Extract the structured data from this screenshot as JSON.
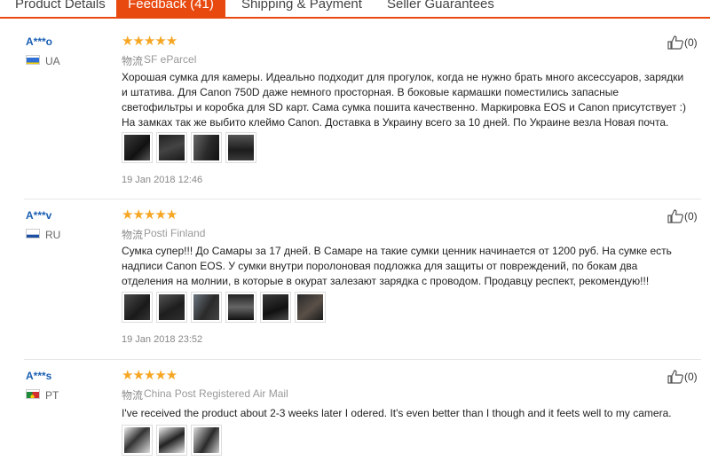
{
  "tabs": [
    {
      "label": "Product Details",
      "active": false
    },
    {
      "label": "Feedback (41)",
      "active": true
    },
    {
      "label": "Shipping & Payment",
      "active": false
    },
    {
      "label": "Seller Guarantees",
      "active": false
    }
  ],
  "accent_color": "#e8490f",
  "reviews": [
    {
      "user": "A***o",
      "country": "UA",
      "stars": "★★★★★",
      "rating": 5,
      "ship_prefix": "物流",
      "ship_method": "SF eParcel",
      "helpful": "(0)",
      "text": "Хорошая сумка для камеры. Идеально подходит для прогулок, когда не нужно брать много аксессуаров, зарядки и штатива. Для Canon 750D даже немного просторная. В боковые кармашки поместились запасные светофильтры и коробка для SD карт. Сама сумка пошита качественно. Маркировка EOS и Canon присутствует :) На замках так же выбито клеймо Canon. Доставка в Украину всего за 10 дней. По Украине везла Новая почта.",
      "date": "19 Jan 2018 12:46",
      "photo_count": 4
    },
    {
      "user": "A***v",
      "country": "RU",
      "stars": "★★★★★",
      "rating": 5,
      "ship_prefix": "物流",
      "ship_method": "Posti Finland",
      "helpful": "(0)",
      "text": "Сумка супер!!! До Самары за 17 дней. В Самаре на такие сумки ценник начинается от 1200 руб. На сумке есть надписи Canon EOS. У сумки внутри поролоновая подложка для защиты от повреждений, по бокам два отделения на молнии, в которые в окурат залезают зарядка с проводом. Продавцу респект, рекомендую!!!",
      "date": "19 Jan 2018 23:52",
      "photo_count": 6
    },
    {
      "user": "A***s",
      "country": "PT",
      "stars": "★★★★★",
      "rating": 5,
      "ship_prefix": "物流",
      "ship_method": "China Post Registered Air Mail",
      "helpful": "(0)",
      "text": "I've received the product about 2-3 weeks later I odered. It's even better than I though and it feets well to my camera.",
      "date": "",
      "photo_count": 3
    }
  ]
}
